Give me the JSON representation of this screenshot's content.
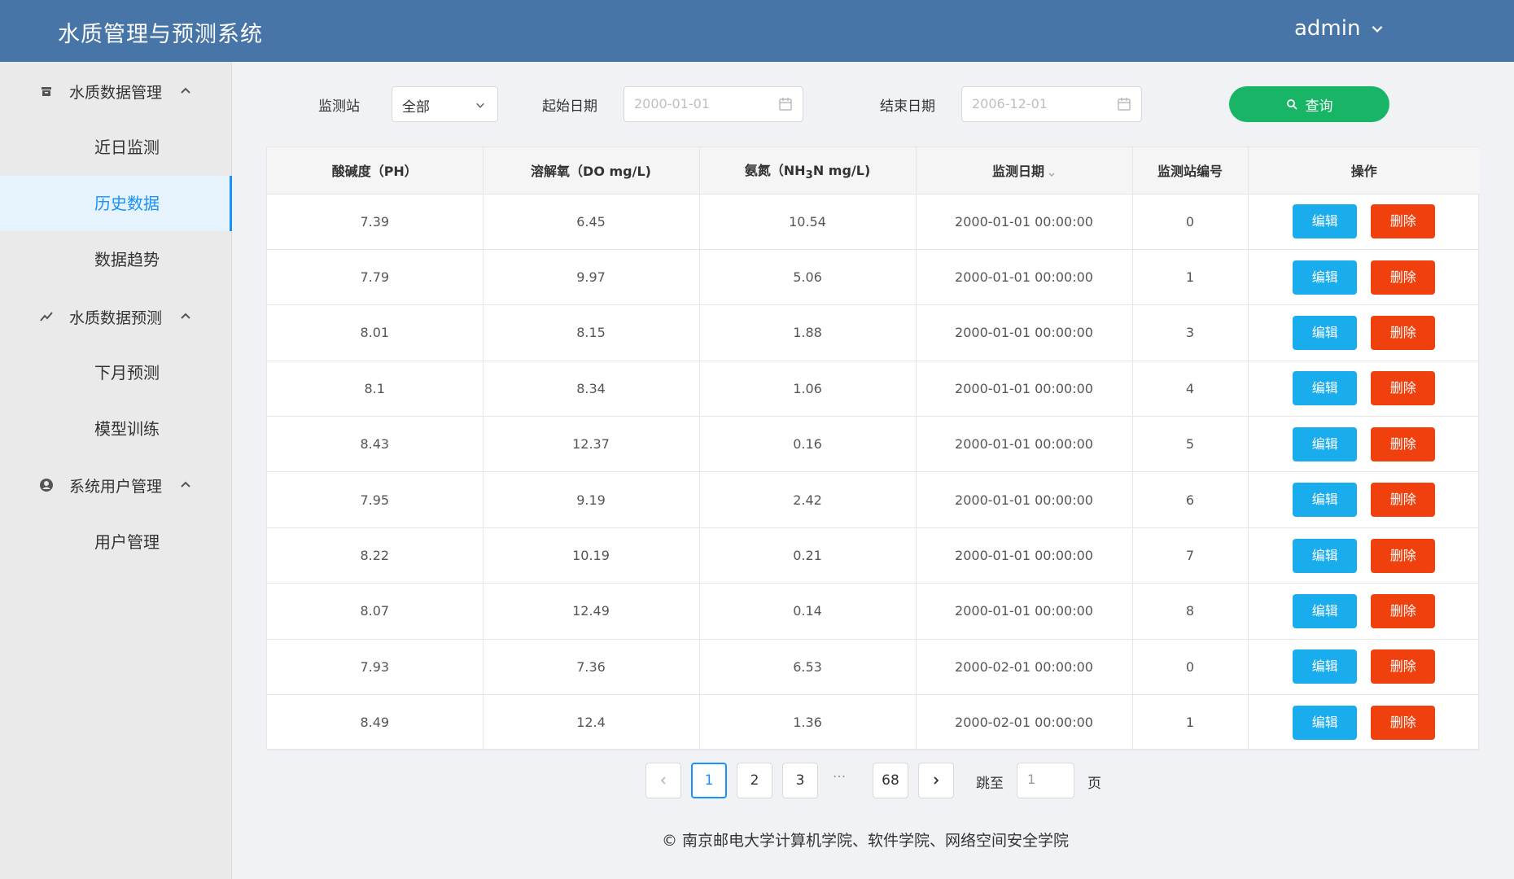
{
  "header": {
    "title": "水质管理与预测系统",
    "user": "admin"
  },
  "sidebar": {
    "group1": {
      "label": "水质数据管理",
      "icon": "archive-icon"
    },
    "item1": "近日监测",
    "item2": "历史数据",
    "item3": "数据趋势",
    "group2": {
      "label": "水质数据预测",
      "icon": "trend-icon"
    },
    "item4": "下月预测",
    "item5": "模型训练",
    "group3": {
      "label": "系统用户管理",
      "icon": "user-icon"
    },
    "item6": "用户管理",
    "active": "历史数据"
  },
  "filters": {
    "station_label": "监测站",
    "station_value": "全部",
    "start_label": "起始日期",
    "start_placeholder": "2000-01-01",
    "end_label": "结束日期",
    "end_placeholder": "2006-12-01",
    "query_label": "查询"
  },
  "table": {
    "headers": {
      "ph": "酸碱度（PH）",
      "do": "溶解氧（DO mg/L)",
      "nh_pre": "氨氮（NH",
      "nh_sub": "3",
      "nh_post": "N mg/L)",
      "date": "监测日期",
      "station": "监测站编号",
      "ops": "操作"
    },
    "edit_label": "编辑",
    "delete_label": "删除",
    "rows": [
      {
        "ph": "7.39",
        "do": "6.45",
        "nh": "10.54",
        "date": "2000-01-01 00:00:00",
        "station": "0"
      },
      {
        "ph": "7.79",
        "do": "9.97",
        "nh": "5.06",
        "date": "2000-01-01 00:00:00",
        "station": "1"
      },
      {
        "ph": "8.01",
        "do": "8.15",
        "nh": "1.88",
        "date": "2000-01-01 00:00:00",
        "station": "3"
      },
      {
        "ph": "8.1",
        "do": "8.34",
        "nh": "1.06",
        "date": "2000-01-01 00:00:00",
        "station": "4"
      },
      {
        "ph": "8.43",
        "do": "12.37",
        "nh": "0.16",
        "date": "2000-01-01 00:00:00",
        "station": "5"
      },
      {
        "ph": "7.95",
        "do": "9.19",
        "nh": "2.42",
        "date": "2000-01-01 00:00:00",
        "station": "6"
      },
      {
        "ph": "8.22",
        "do": "10.19",
        "nh": "0.21",
        "date": "2000-01-01 00:00:00",
        "station": "7"
      },
      {
        "ph": "8.07",
        "do": "12.49",
        "nh": "0.14",
        "date": "2000-01-01 00:00:00",
        "station": "8"
      },
      {
        "ph": "7.93",
        "do": "7.36",
        "nh": "6.53",
        "date": "2000-02-01 00:00:00",
        "station": "0"
      },
      {
        "ph": "8.49",
        "do": "12.4",
        "nh": "1.36",
        "date": "2000-02-01 00:00:00",
        "station": "1"
      }
    ]
  },
  "pagination": {
    "p1": "1",
    "p2": "2",
    "p3": "3",
    "ellipsis": "···",
    "last": "68",
    "jump_label": "跳至",
    "jump_value": "1",
    "page_suffix": "页"
  },
  "footer": {
    "text": "© 南京邮电大学计算机学院、软件学院、网络空间安全学院"
  },
  "colors": {
    "header": "#4775a7",
    "accent": "#1890ff",
    "query": "#18b566",
    "edit": "#1aadee",
    "delete": "#f0400e"
  }
}
